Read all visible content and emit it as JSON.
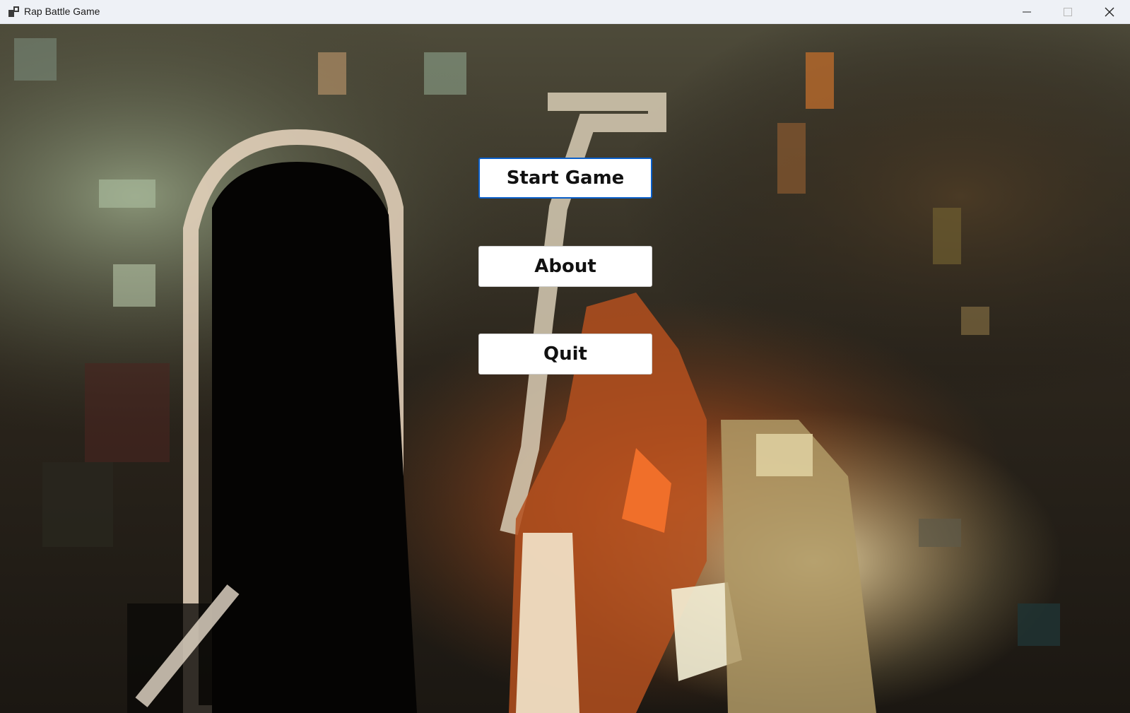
{
  "window": {
    "title": "Rap Battle Game",
    "icons": {
      "app": "app-icon",
      "minimize": "minimize-icon",
      "maximize": "maximize-icon",
      "close": "close-icon"
    }
  },
  "background": {
    "description_icon": "pixelated-rapper-background"
  },
  "menu": {
    "buttons": [
      {
        "label": "Start Game",
        "focused": true
      },
      {
        "label": "About",
        "focused": false
      },
      {
        "label": "Quit",
        "focused": false
      }
    ]
  },
  "colors": {
    "focus_border": "#0a5ec8",
    "button_bg": "#ffffff"
  }
}
